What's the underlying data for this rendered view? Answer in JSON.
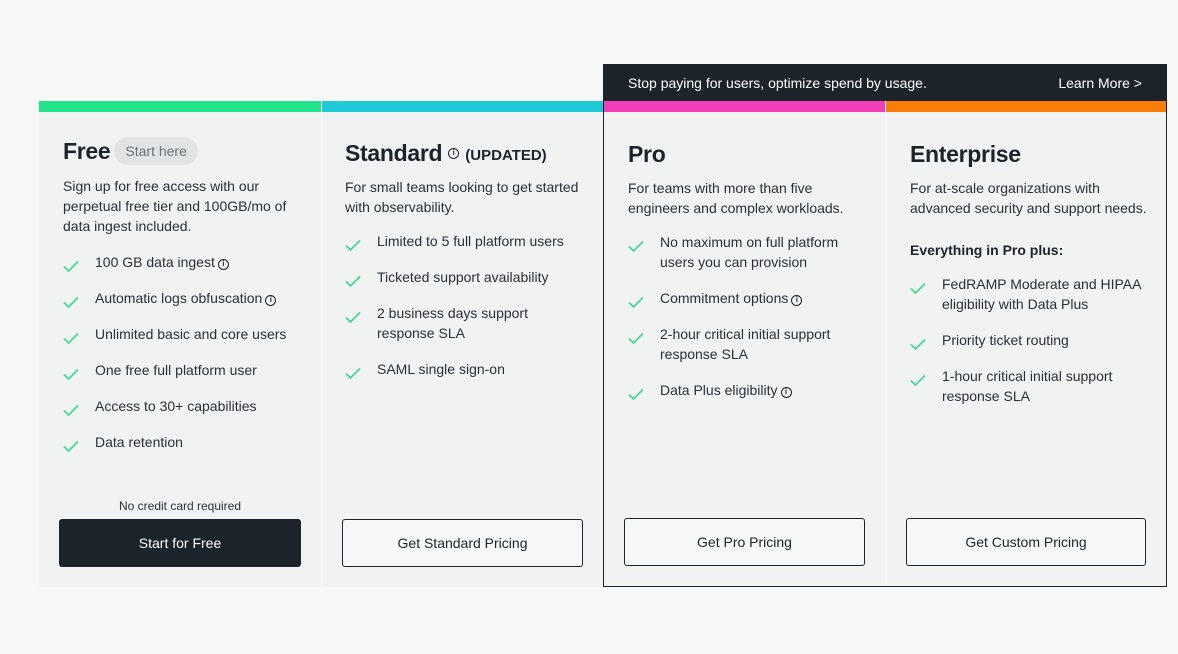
{
  "banner": {
    "text": "Stop paying for users, optimize spend by usage.",
    "link": "Learn More >"
  },
  "colors": {
    "free": "#22e38a",
    "standard": "#1fc9d6",
    "pro": "#f23fb8",
    "enterprise": "#fa7d0a",
    "check": "#3ad68e",
    "dark": "#1d232b"
  },
  "plans": [
    {
      "name": "Free",
      "badge": "Start here",
      "description": "Sign up for free access with our perpetual free tier and 100GB/mo of data ingest included.",
      "features": [
        {
          "text": "100 GB data ingest",
          "info": true
        },
        {
          "text": "Automatic logs obfuscation",
          "info": true
        },
        {
          "text": "Unlimited basic and core users",
          "info": false
        },
        {
          "text": "One free full platform user",
          "info": false
        },
        {
          "text": "Access to 30+ capabilities",
          "info": false
        },
        {
          "text": "Data retention",
          "info": false
        }
      ],
      "footnote": "No credit card required",
      "cta": "Start for Free"
    },
    {
      "name": "Standard",
      "tag": "(UPDATED)",
      "description": "For small teams looking to get started with observability.",
      "features": [
        {
          "text": "Limited to 5 full platform users"
        },
        {
          "text": "Ticketed support availability"
        },
        {
          "text": "2 business days support response SLA"
        },
        {
          "text": "SAML single sign-on"
        }
      ],
      "cta": "Get Standard Pricing"
    },
    {
      "name": "Pro",
      "description": "For teams with more than five engineers and complex workloads.",
      "features": [
        {
          "text": "No maximum on full platform users you can provision"
        },
        {
          "text": "Commitment options",
          "info": true
        },
        {
          "text": "2-hour critical initial support response SLA"
        },
        {
          "text": "Data Plus eligibility",
          "info": true
        }
      ],
      "cta": "Get Pro Pricing"
    },
    {
      "name": "Enterprise",
      "description": "For at-scale organizations with advanced security and support needs.",
      "heading": "Everything in Pro plus:",
      "features": [
        {
          "text": "FedRAMP Moderate and HIPAA eligibility with Data Plus"
        },
        {
          "text": "Priority ticket routing"
        },
        {
          "text": "1-hour critical initial support response SLA"
        }
      ],
      "cta": "Get Custom Pricing"
    }
  ]
}
